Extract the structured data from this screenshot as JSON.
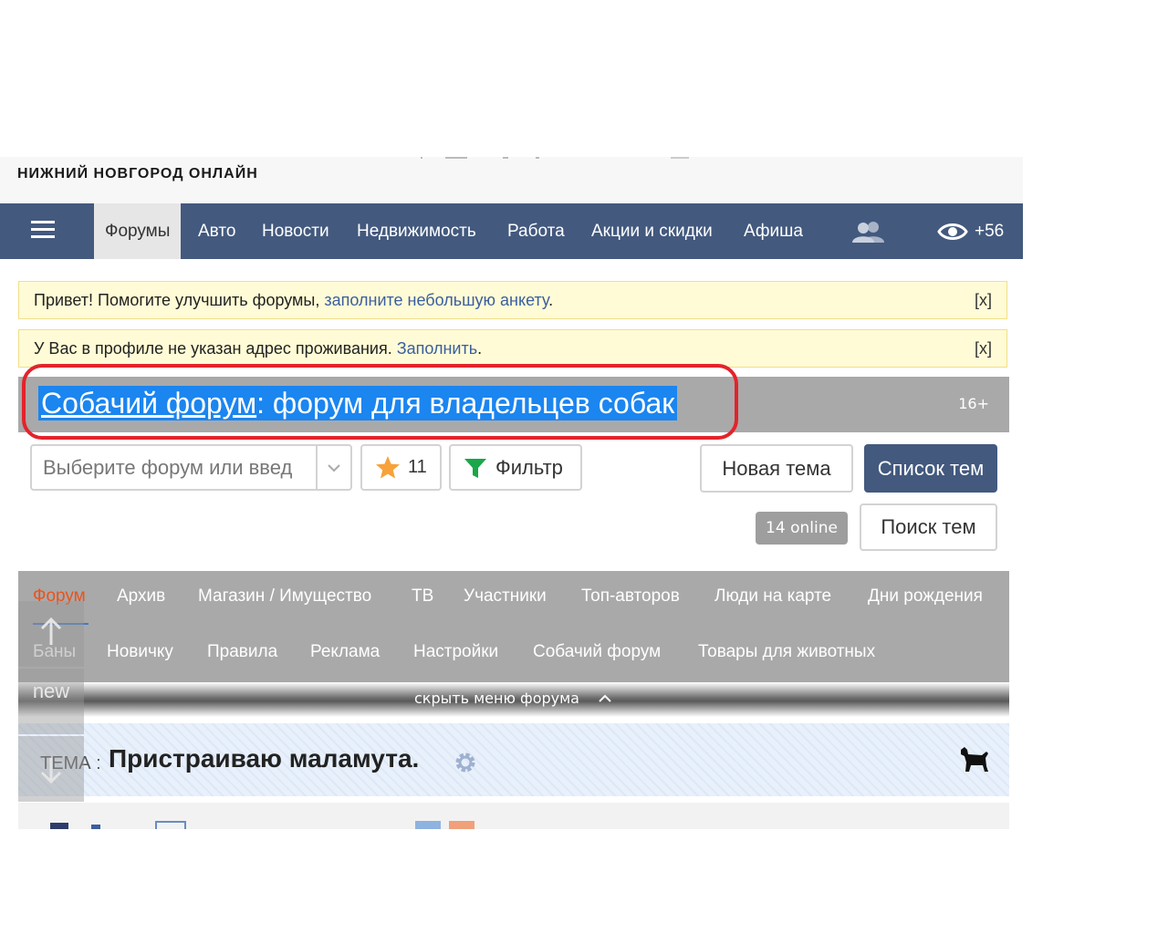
{
  "header": {
    "site_subtitle": "НИЖНИЙ НОВГОРОД ОНЛАЙН"
  },
  "nav": {
    "items": [
      {
        "label": "Форумы",
        "active": true
      },
      {
        "label": "Авто"
      },
      {
        "label": "Новости"
      },
      {
        "label": "Недвижимость"
      },
      {
        "label": "Работа"
      },
      {
        "label": "Акции и скидки"
      },
      {
        "label": "Афиша"
      }
    ],
    "views_count": "+56",
    "icons": [
      "menu-icon",
      "users-icon",
      "eye-icon"
    ]
  },
  "notices": [
    {
      "text": "Привет! Помогите улучшить форумы, ",
      "link": "заполните небольшую анкету",
      "after": ".",
      "close": "[x]"
    },
    {
      "text": "У Вас в профиле не указан адрес проживания. ",
      "link": "Заполнить",
      "after": ".",
      "close": "[x]"
    }
  ],
  "forum": {
    "title_link": "Собачий форум",
    "title_rest": ": форум для владельцев собак",
    "age_rating": "16+",
    "highlight_color": "#1b85f0",
    "annotation_color": "#e3232b"
  },
  "toolbar": {
    "forum_select_placeholder": "Выберите форум или введ",
    "favorites_count": "11",
    "filter_label": "Фильтр",
    "new_topic_label": "Новая тема",
    "topic_list_label": "Список тем",
    "online_badge": "14 online",
    "search_topics_label": "Поиск тем"
  },
  "forum_menu": {
    "row1": [
      "Форум",
      "Архив",
      "Магазин / Имущество",
      "ТВ",
      "Участники",
      "Топ-авторов",
      "Люди на карте",
      "Дни рождения"
    ],
    "row2": [
      "Баны",
      "Новичку",
      "Правила",
      "Реклама",
      "Настройки",
      "Собачий форум",
      "Товары для животных"
    ],
    "active_item": "Форум",
    "hide_label": "скрыть меню форума"
  },
  "side_helpers": {
    "new_label": "new"
  },
  "topic": {
    "label": "ТЕМА :",
    "title": "Пристраиваю маламута."
  },
  "colors": {
    "nav_bg": "#43597e",
    "active_menu": "#e9531c",
    "notice_bg": "#fffbd6",
    "link": "#3a5f9e"
  }
}
